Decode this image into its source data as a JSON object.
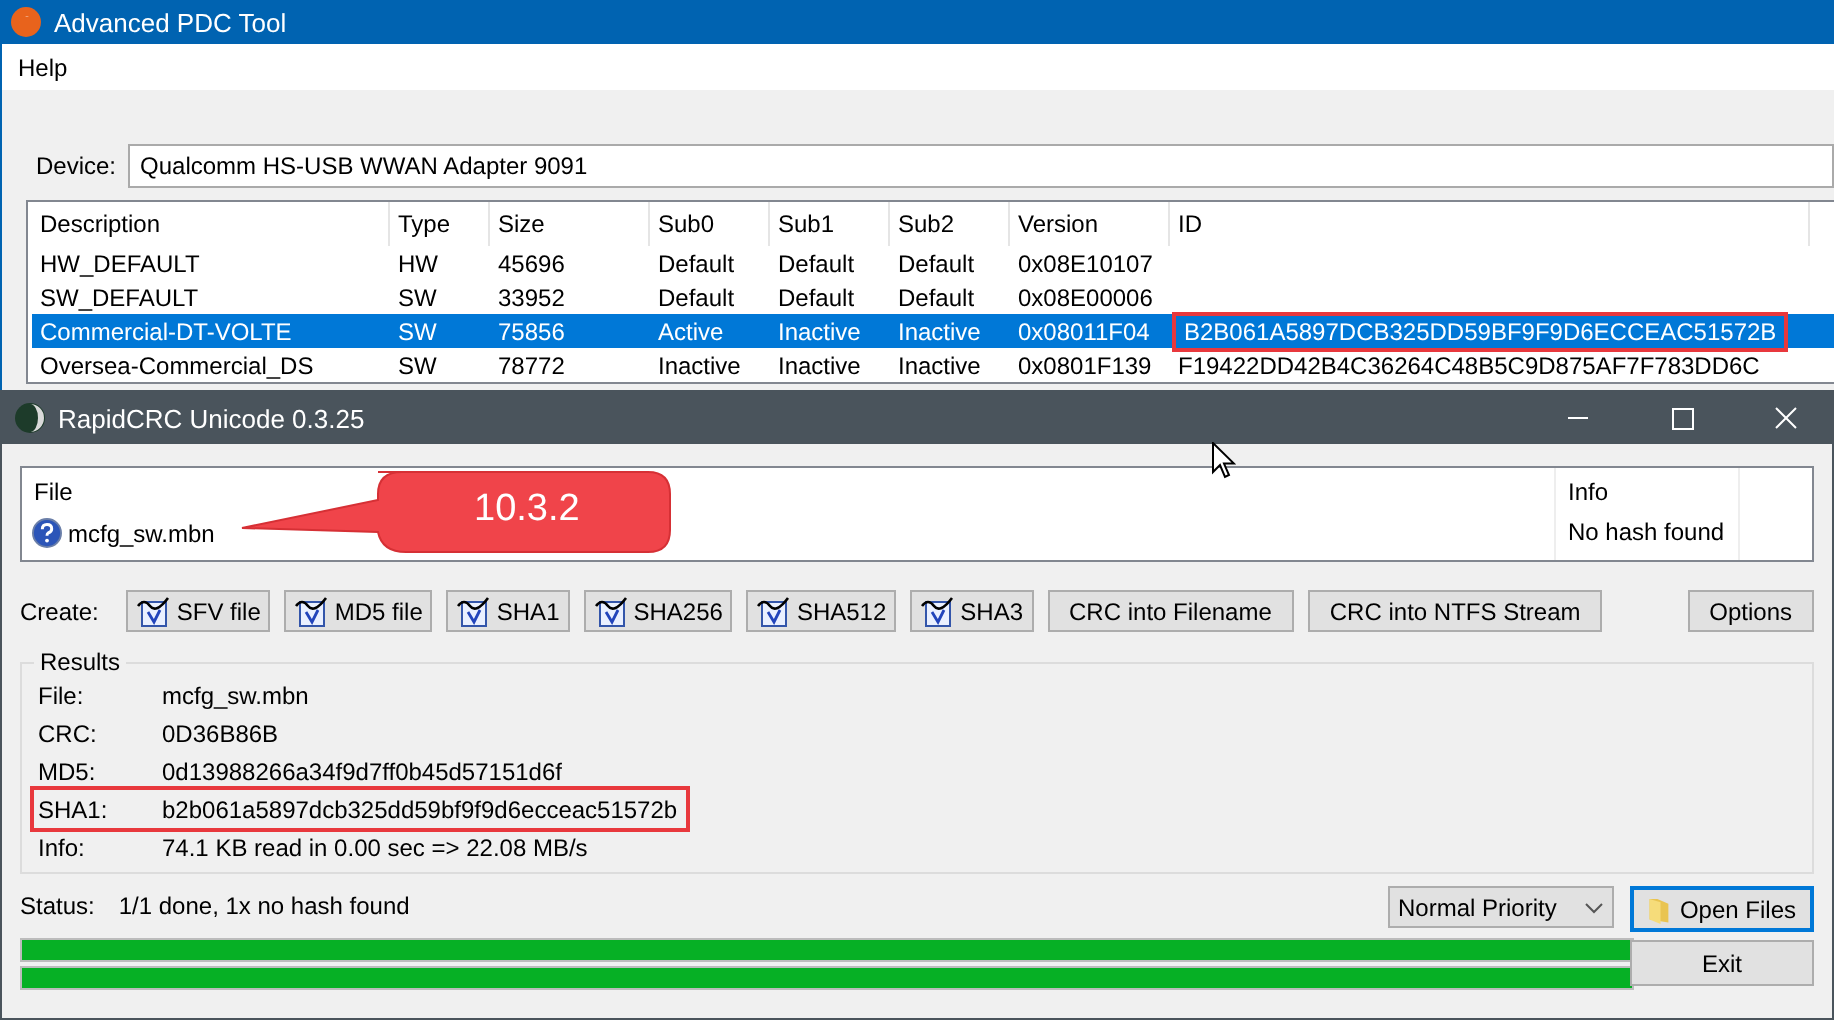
{
  "pdc_window": {
    "title": "Advanced PDC Tool",
    "menu": [
      "Help"
    ],
    "device_label": "Device:",
    "device": "Qualcomm HS-USB WWAN Adapter 9091",
    "table": {
      "columns": [
        "Description",
        "Type",
        "Size",
        "Sub0",
        "Sub1",
        "Sub2",
        "Version",
        "ID"
      ],
      "rows": [
        {
          "description": "HW_DEFAULT",
          "type": "HW",
          "size": "45696",
          "sub0": "Default",
          "sub1": "Default",
          "sub2": "Default",
          "version": "0x08E10107",
          "selected": false
        },
        {
          "description": "SW_DEFAULT",
          "type": "SW",
          "size": "33952",
          "sub0": "Default",
          "sub1": "Default",
          "sub2": "Default",
          "version": "0x08E00006",
          "selected": false
        },
        {
          "description": "Commercial-DT-VOLTE",
          "type": "SW",
          "size": "75856",
          "sub0": "Active",
          "sub1": "Inactive",
          "sub2": "Inactive",
          "version": "0x08011F04",
          "id": "B2B061A5897DCB325DD59BF9F9D6ECCEAC51572B",
          "id_marked": true,
          "selected": true
        },
        {
          "description": "Oversea-Commercial_DS",
          "type": "SW",
          "size": "78772",
          "sub0": "Inactive",
          "sub1": "Inactive",
          "sub2": "Inactive",
          "version": "0x0801F139",
          "id": "F19422DD42B4C36264C48B5C9D875AF7F783DD6C",
          "id_marked": false,
          "selected": false
        }
      ]
    }
  },
  "crc_window": {
    "title": "RapidCRC Unicode 0.3.25",
    "file_panel": {
      "columns": [
        "File",
        "Info"
      ],
      "file": "mcfg_sw.mbn",
      "info": "No hash found"
    },
    "callout": "10.3.2",
    "create_label": "Create:",
    "create_buttons": [
      {
        "label": "SFV file",
        "kind": "icon"
      },
      {
        "label": "MD5 file",
        "kind": "icon"
      },
      {
        "label": "SHA1",
        "kind": "icon"
      },
      {
        "label": "SHA256",
        "kind": "icon"
      },
      {
        "label": "SHA512",
        "kind": "icon"
      },
      {
        "label": "SHA3",
        "kind": "icon"
      },
      {
        "label": "CRC into Filename",
        "kind": "plain"
      },
      {
        "label": "CRC into NTFS Stream",
        "kind": "plain"
      }
    ],
    "options_button": "Options",
    "results": {
      "title": "Results",
      "rows": [
        {
          "label": "File:",
          "value": "mcfg_sw.mbn",
          "marked": false
        },
        {
          "label": "CRC:",
          "value": "0D36B86B",
          "marked": false
        },
        {
          "label": "MD5:",
          "value": "0d13988266a34f9d7ff0b45d57151d6f",
          "marked": false
        },
        {
          "label": "SHA1:",
          "value": "b2b061a5897dcb325dd59bf9f9d6ecceac51572b",
          "marked": true
        },
        {
          "label": "Info:",
          "value": "74.1 KB read in 0.00 sec => 22.08 MB/s",
          "marked": false
        }
      ]
    },
    "status_label": "Status:",
    "status": "1/1 done, 1x no hash found",
    "progress": [
      {
        "level": 1
      },
      {
        "level": 1
      }
    ],
    "priority": "Normal Priority",
    "open_button": {
      "label": "Open Files",
      "focused": true
    },
    "exit_button": "Exit"
  }
}
